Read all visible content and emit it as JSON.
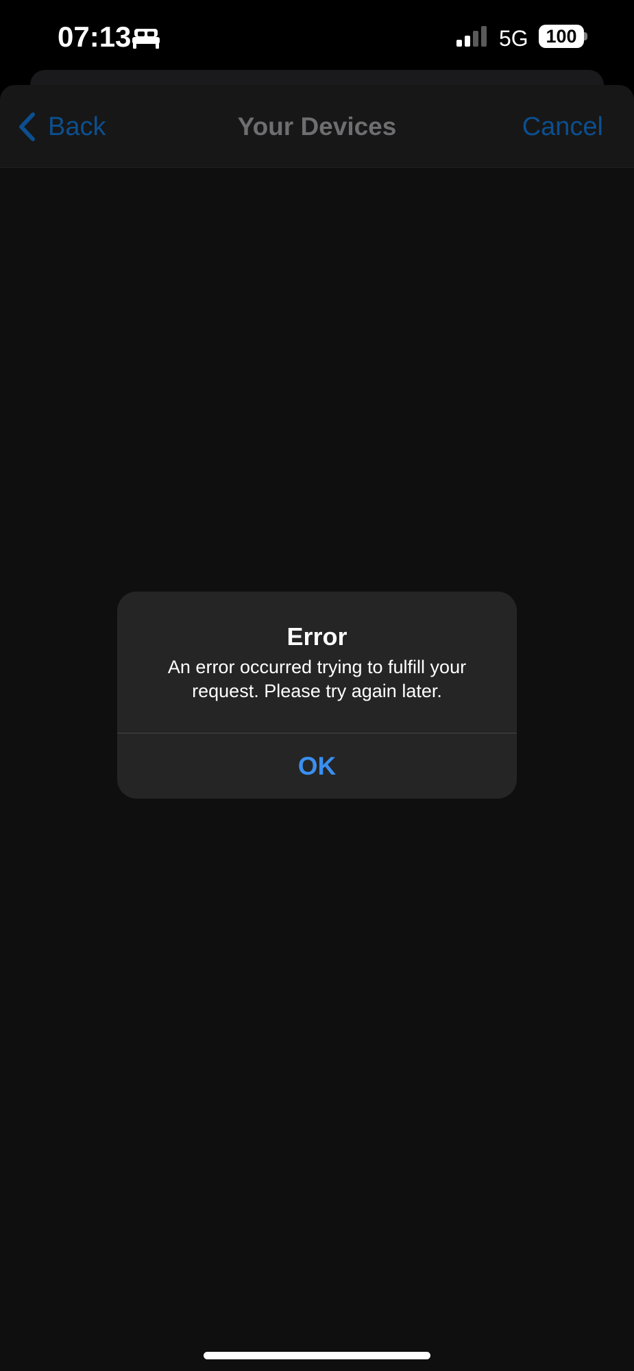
{
  "status_bar": {
    "time": "07:13",
    "focus_icon": "bed-icon",
    "network": "5G",
    "battery_level": "100"
  },
  "nav": {
    "back_label": "Back",
    "title": "Your Devices",
    "cancel_label": "Cancel"
  },
  "alert": {
    "title": "Error",
    "message": "An error occurred trying to fulfill your request. Please try again later.",
    "ok_label": "OK"
  },
  "colors": {
    "accent": "#3a8ff0",
    "dimmed_accent": "#0c4f8f",
    "background": "#0f0f0f",
    "alert_background": "#252525"
  }
}
